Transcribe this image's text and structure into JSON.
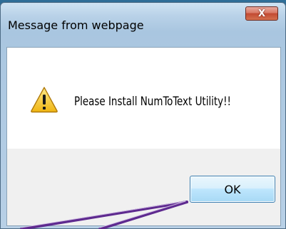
{
  "backdrop": {
    "fragment_text": ""
  },
  "dialog": {
    "title": "Message from webpage",
    "close_label": "X",
    "message": "Please Install NumToText Utility!!",
    "ok_label": "OK",
    "icon": "warning-icon"
  },
  "annotation": {
    "type": "arrow",
    "color": "#6a2fa0",
    "points_to": "ok-button"
  },
  "colors": {
    "close_button": "#c24a32",
    "ok_button_border": "#3c7fb1",
    "warning_yellow": "#f3c21a"
  }
}
